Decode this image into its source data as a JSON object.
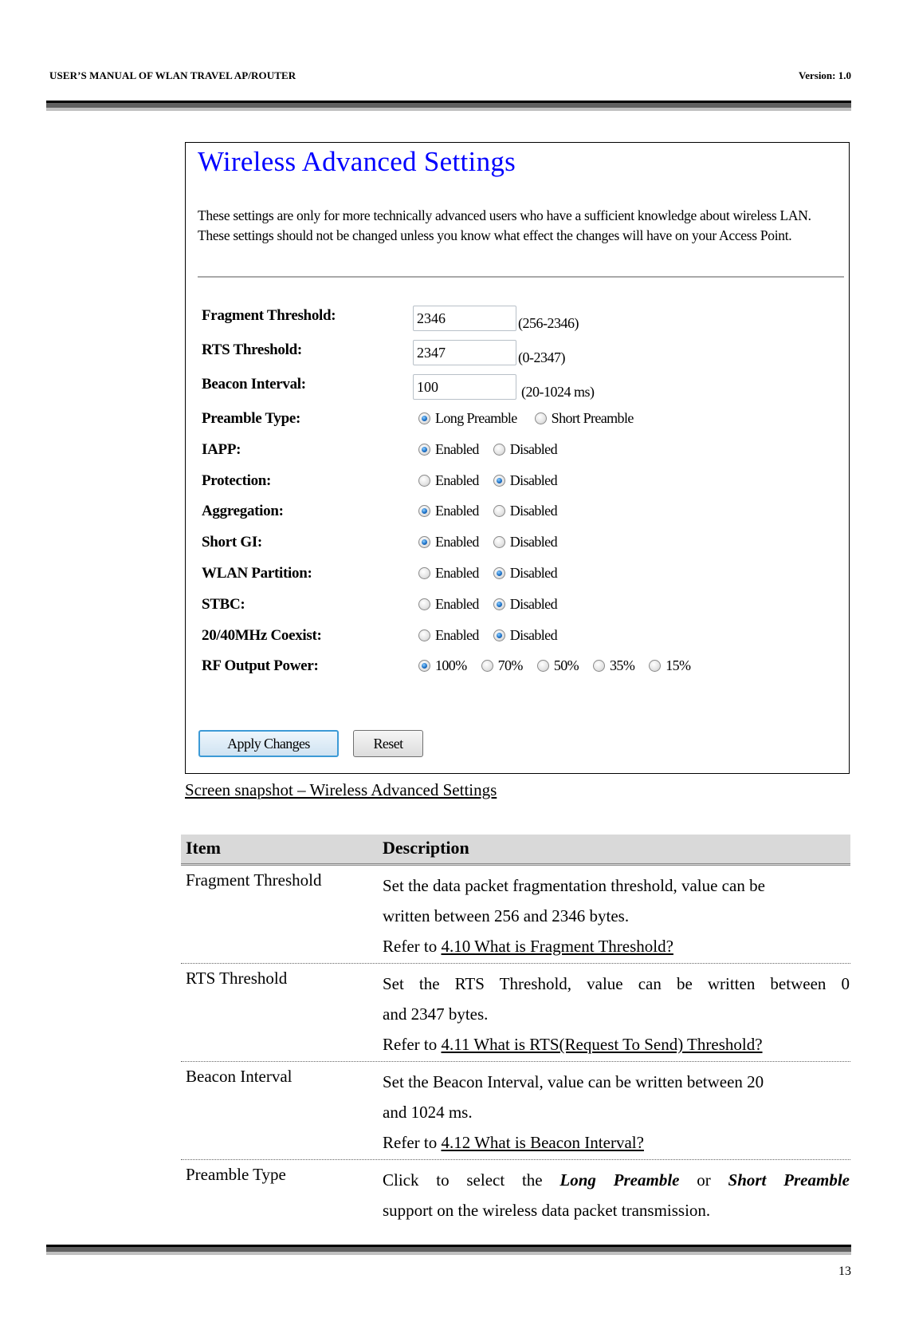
{
  "page_header": {
    "title": "USER’S MANUAL OF WLAN TRAVEL AP/ROUTER",
    "version": "Version: 1.0"
  },
  "snapshot": {
    "title": "Wireless Advanced Settings",
    "description": "These settings are only for more technically advanced users who have a sufficient knowledge about wireless LAN. These settings should not be changed unless you know what effect the changes will have on your Access Point.",
    "fields": {
      "fragment_threshold": {
        "label": "Fragment Threshold:",
        "value": "2346",
        "range": "(256-2346)"
      },
      "rts_threshold": {
        "label": "RTS Threshold:",
        "value": "2347",
        "range": "(0-2347)"
      },
      "beacon_interval": {
        "label": "Beacon Interval:",
        "value": "100",
        "range": "(20-1024 ms)"
      }
    },
    "radio_groups": [
      {
        "label": "Preamble Type:",
        "options": [
          {
            "label": "Long Preamble",
            "selected": true
          },
          {
            "label": "Short Preamble",
            "selected": false
          }
        ]
      },
      {
        "label": "IAPP:",
        "options": [
          {
            "label": "Enabled",
            "selected": true
          },
          {
            "label": "Disabled",
            "selected": false
          }
        ]
      },
      {
        "label": "Protection:",
        "options": [
          {
            "label": "Enabled",
            "selected": false
          },
          {
            "label": "Disabled",
            "selected": true
          }
        ]
      },
      {
        "label": "Aggregation:",
        "options": [
          {
            "label": "Enabled",
            "selected": true
          },
          {
            "label": "Disabled",
            "selected": false
          }
        ]
      },
      {
        "label": "Short GI:",
        "options": [
          {
            "label": "Enabled",
            "selected": true
          },
          {
            "label": "Disabled",
            "selected": false
          }
        ]
      },
      {
        "label": "WLAN Partition:",
        "options": [
          {
            "label": "Enabled",
            "selected": false
          },
          {
            "label": "Disabled",
            "selected": true
          }
        ]
      },
      {
        "label": "STBC:",
        "options": [
          {
            "label": "Enabled",
            "selected": false
          },
          {
            "label": "Disabled",
            "selected": true
          }
        ]
      },
      {
        "label": "20/40MHz Coexist:",
        "options": [
          {
            "label": "Enabled",
            "selected": false
          },
          {
            "label": "Disabled",
            "selected": true
          }
        ]
      },
      {
        "label": "RF Output Power:",
        "options": [
          {
            "label": "100%",
            "selected": true
          },
          {
            "label": "70%",
            "selected": false
          },
          {
            "label": "50%",
            "selected": false
          },
          {
            "label": "35%",
            "selected": false
          },
          {
            "label": "15%",
            "selected": false
          }
        ]
      }
    ],
    "buttons": {
      "apply": "Apply Changes",
      "reset": "Reset"
    }
  },
  "caption": "Screen snapshot – Wireless Advanced Settings",
  "table": {
    "headers": {
      "item": "Item",
      "description": "Description"
    },
    "rows": [
      {
        "item": "Fragment Threshold",
        "lines": [
          "Set the data packet fragmentation threshold, value can be",
          "written between 256 and 2346 bytes."
        ],
        "ref_prefix": "Refer to ",
        "ref_link": "4.10 What is Fragment Threshold?"
      },
      {
        "item": "RTS Threshold",
        "lines": [
          "Set the RTS Threshold, value can be written between 0",
          "and 2347 bytes."
        ],
        "ref_prefix": "Refer to ",
        "ref_link": "4.11 What is RTS(Request To Send) Threshold?"
      },
      {
        "item": "Beacon Interval",
        "lines": [
          "Set the Beacon Interval, value can be written between 20",
          "and 1024 ms."
        ],
        "ref_prefix": "Refer to ",
        "ref_link": "4.12 What is Beacon Interval?"
      },
      {
        "item": "Preamble Type",
        "text_before": "Click to select the ",
        "emph1": "Long Preamble",
        "text_mid": " or ",
        "emph2": "Short Preamble",
        "text_after": "support on the wireless data packet transmission."
      }
    ]
  },
  "page_number": "13"
}
